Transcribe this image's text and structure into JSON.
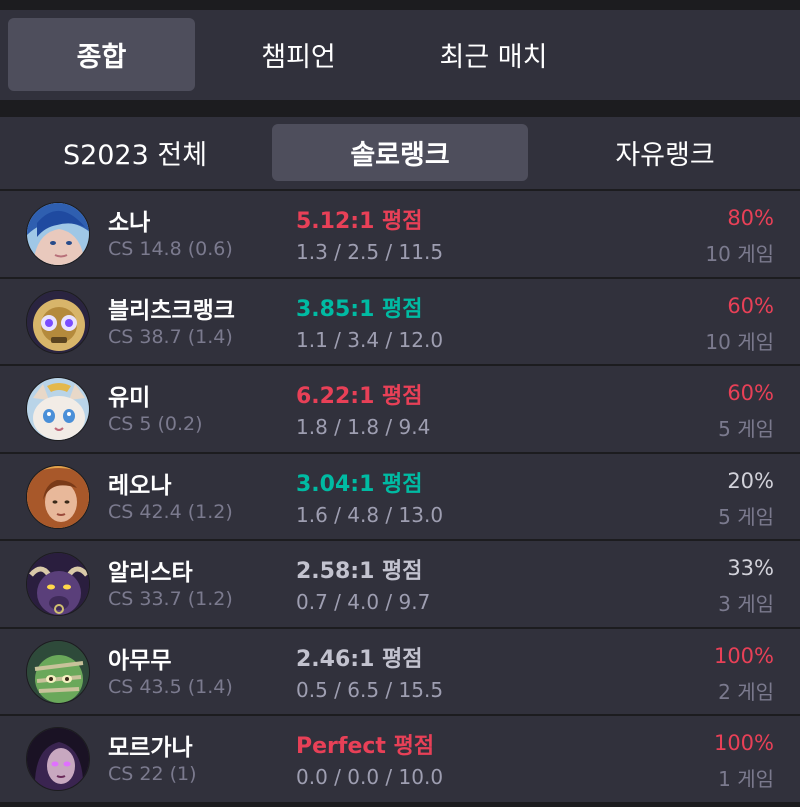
{
  "main_tabs": [
    {
      "label": "종합",
      "active": true
    },
    {
      "label": "챔피언",
      "active": false
    },
    {
      "label": "최근 매치",
      "active": false
    }
  ],
  "sub_tabs": [
    {
      "label": "S2023 전체",
      "active": false
    },
    {
      "label": "솔로랭크",
      "active": true
    },
    {
      "label": "자유랭크",
      "active": false
    }
  ],
  "colors": {
    "high_kda": "#e84057",
    "good_kda": "#00bba3",
    "normal_kda": "#c3c3cf",
    "high_winrate": "#e84057",
    "normal_winrate": "#d2d2da"
  },
  "champions": [
    {
      "name": "소나",
      "cs": "CS 14.8 (0.6)",
      "kda_ratio": "5.12:1 평점",
      "kda_color": "red",
      "kda": "1.3 / 2.5 / 11.5",
      "winrate": "80%",
      "winrate_color": "red",
      "games": "10 게임",
      "icon": "sona-portrait"
    },
    {
      "name": "블리츠크랭크",
      "cs": "CS 38.7 (1.4)",
      "kda_ratio": "3.85:1 평점",
      "kda_color": "teal",
      "kda": "1.1 / 3.4 / 12.0",
      "winrate": "60%",
      "winrate_color": "red",
      "games": "10 게임",
      "icon": "blitzcrank-portrait"
    },
    {
      "name": "유미",
      "cs": "CS 5 (0.2)",
      "kda_ratio": "6.22:1 평점",
      "kda_color": "red",
      "kda": "1.8 / 1.8 / 9.4",
      "winrate": "60%",
      "winrate_color": "red",
      "games": "5 게임",
      "icon": "yuumi-portrait"
    },
    {
      "name": "레오나",
      "cs": "CS 42.4 (1.2)",
      "kda_ratio": "3.04:1 평점",
      "kda_color": "teal",
      "kda": "1.6 / 4.8 / 13.0",
      "winrate": "20%",
      "winrate_color": "white",
      "games": "5 게임",
      "icon": "leona-portrait"
    },
    {
      "name": "알리스타",
      "cs": "CS 33.7 (1.2)",
      "kda_ratio": "2.58:1 평점",
      "kda_color": "grey",
      "kda": "0.7 / 4.0 / 9.7",
      "winrate": "33%",
      "winrate_color": "white",
      "games": "3 게임",
      "icon": "alistar-portrait"
    },
    {
      "name": "아무무",
      "cs": "CS 43.5 (1.4)",
      "kda_ratio": "2.46:1 평점",
      "kda_color": "grey",
      "kda": "0.5 / 6.5 / 15.5",
      "winrate": "100%",
      "winrate_color": "red",
      "games": "2 게임",
      "icon": "amumu-portrait"
    },
    {
      "name": "모르가나",
      "cs": "CS 22 (1)",
      "kda_ratio": "Perfect 평점",
      "kda_color": "red",
      "kda": "0.0 / 0.0 / 10.0",
      "winrate": "100%",
      "winrate_color": "red",
      "games": "1 게임",
      "icon": "morgana-portrait"
    }
  ]
}
